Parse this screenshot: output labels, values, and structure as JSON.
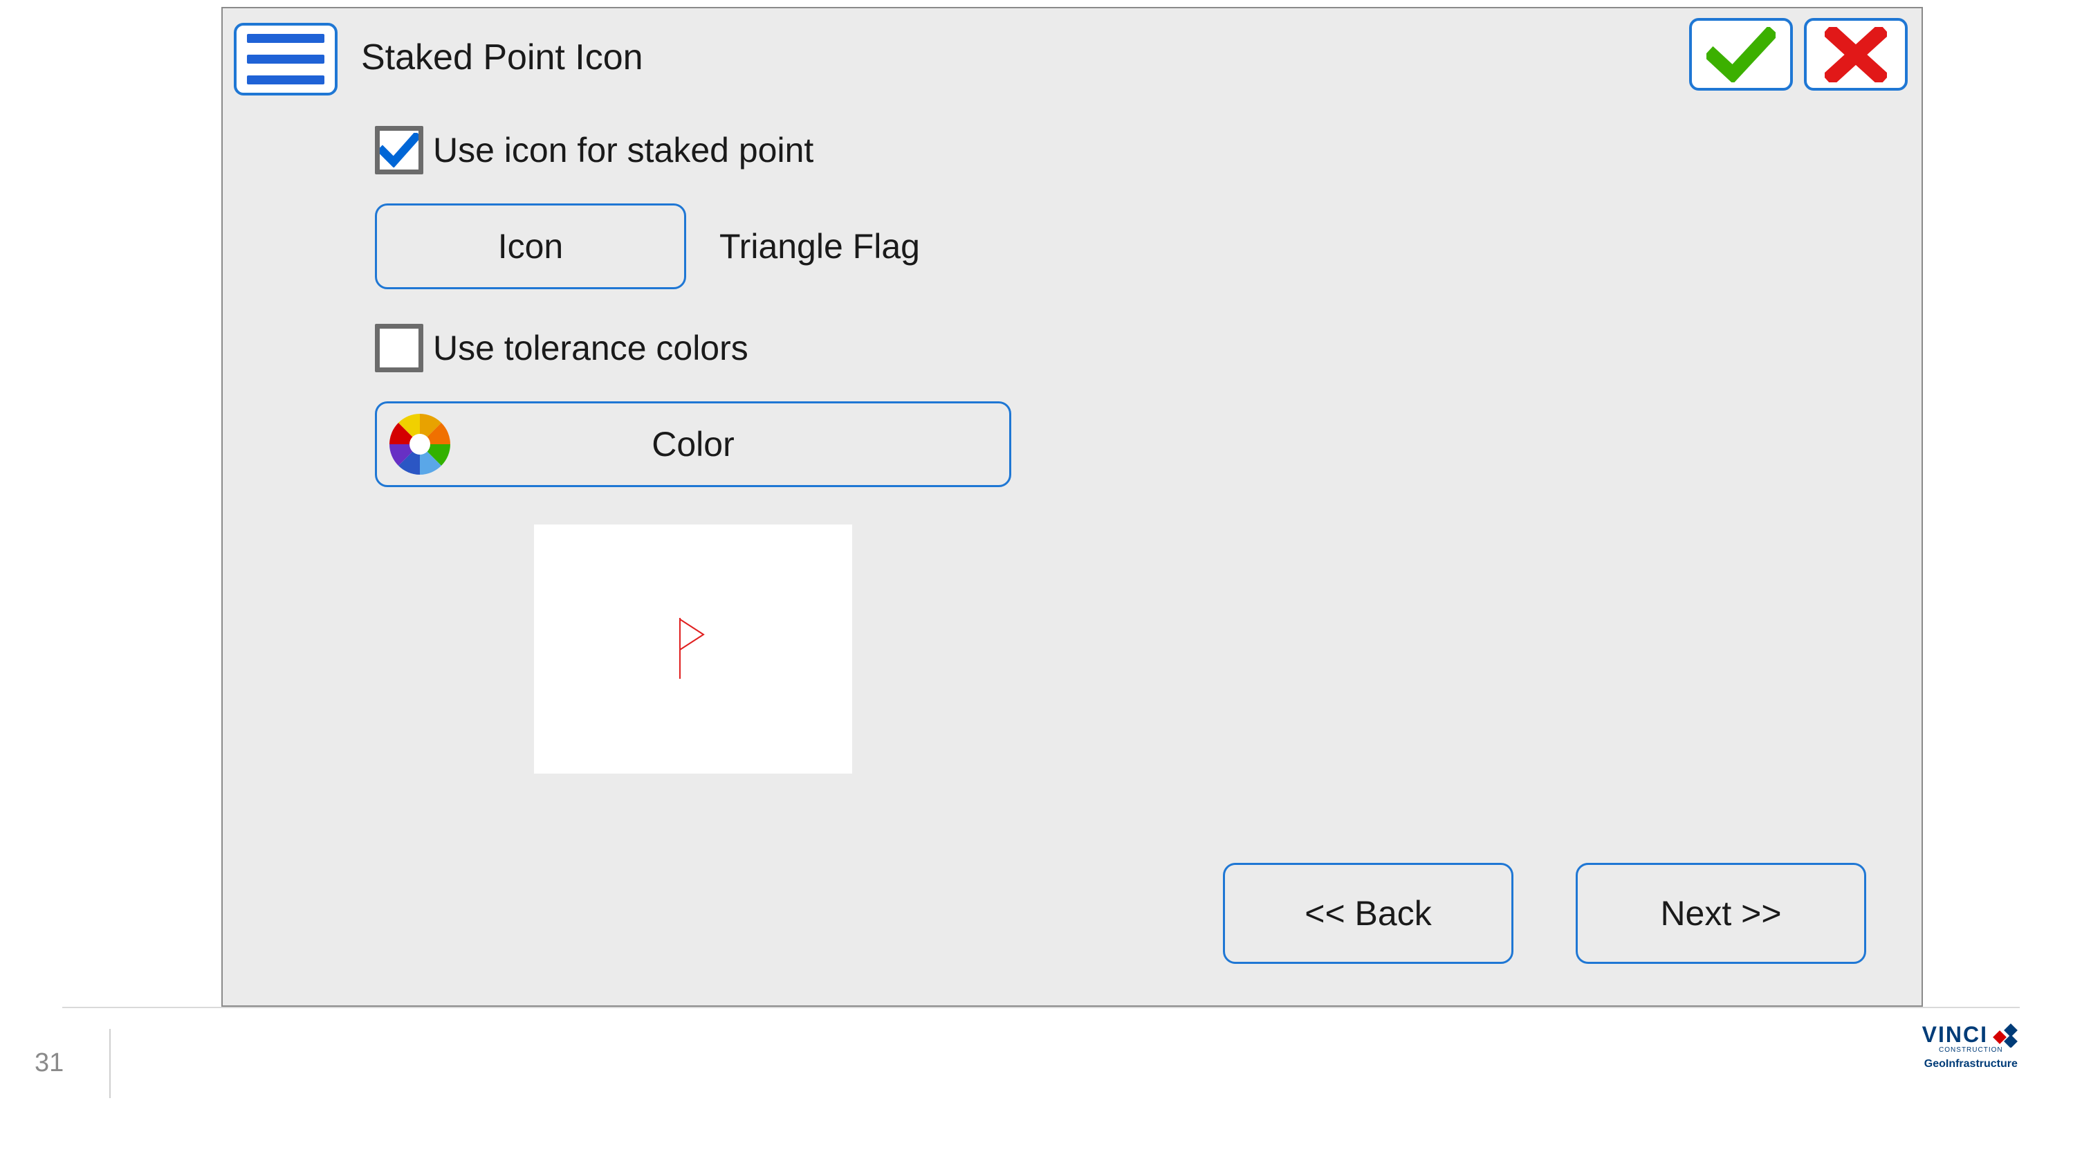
{
  "header": {
    "title": "Staked Point Icon"
  },
  "options": {
    "use_icon_label": "Use icon for staked point",
    "use_icon_checked": true,
    "icon_button_label": "Icon",
    "icon_value": "Triangle Flag",
    "use_tolerance_label": "Use tolerance colors",
    "use_tolerance_checked": false,
    "color_button_label": "Color"
  },
  "nav": {
    "back_label": "<< Back",
    "next_label": "Next >>"
  },
  "footer": {
    "page_number": "31",
    "logo_text": "VINCI",
    "logo_sub1": "CONSTRUCTION",
    "logo_sub2": "GeoInfrastructure"
  }
}
